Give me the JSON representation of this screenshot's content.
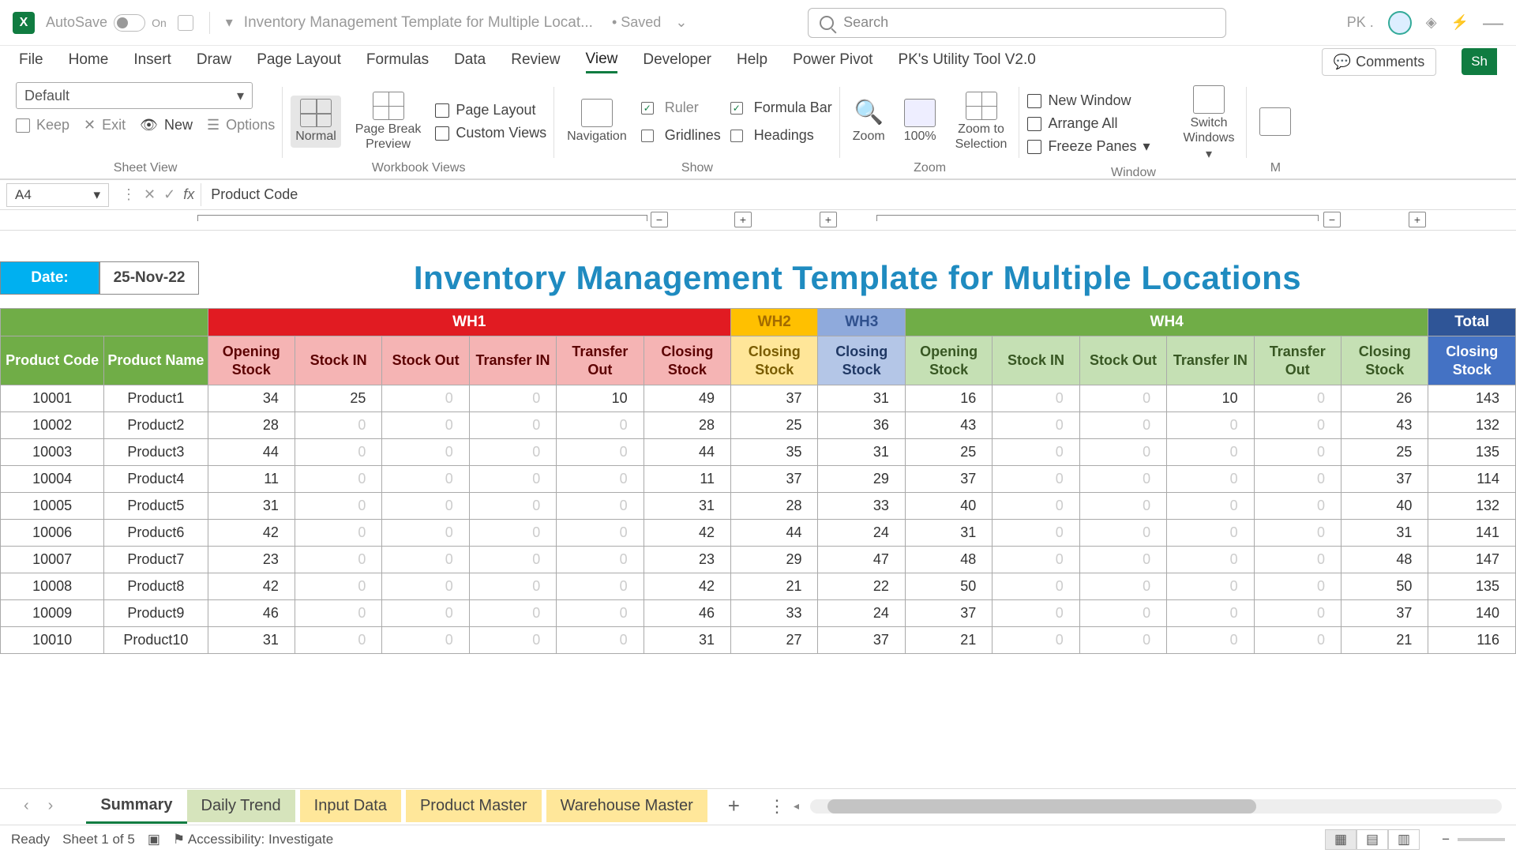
{
  "titlebar": {
    "autosave": "AutoSave",
    "autosave_state": "On",
    "doc_title": "Inventory Management Template for Multiple Locat...",
    "save_status": "• Saved",
    "search_placeholder": "Search",
    "user": "PK ."
  },
  "menu": {
    "tabs": [
      "File",
      "Home",
      "Insert",
      "Draw",
      "Page Layout",
      "Formulas",
      "Data",
      "Review",
      "View",
      "Developer",
      "Help",
      "Power Pivot",
      "PK's Utility Tool V2.0"
    ],
    "active": "View",
    "comments": "Comments",
    "share": "Sh"
  },
  "ribbon": {
    "sheetview": {
      "select": "Default",
      "keep": "Keep",
      "exit": "Exit",
      "new": "New",
      "options": "Options",
      "label": "Sheet View"
    },
    "workbook": {
      "normal": "Normal",
      "page_break": "Page Break\nPreview",
      "page_layout": "Page Layout",
      "custom_views": "Custom Views",
      "label": "Workbook Views"
    },
    "show": {
      "navigation": "Navigation",
      "ruler": "Ruler",
      "gridlines": "Gridlines",
      "formula_bar": "Formula Bar",
      "headings": "Headings",
      "label": "Show"
    },
    "zoom": {
      "zoom": "Zoom",
      "hundred": "100%",
      "selection": "Zoom to\nSelection",
      "label": "Zoom"
    },
    "window": {
      "new_window": "New Window",
      "arrange_all": "Arrange All",
      "freeze": "Freeze Panes",
      "switch": "Switch\nWindows",
      "label": "Window"
    },
    "macros": "M"
  },
  "formula": {
    "cell": "A4",
    "value": "Product Code"
  },
  "sheet": {
    "date_label": "Date:",
    "date_value": "25-Nov-22",
    "title": "Inventory Management Template for Multiple Locations",
    "warehouses": [
      "WH1",
      "WH2",
      "WH3",
      "WH4",
      "Total"
    ],
    "cols_info": [
      "Product Code",
      "Product Name"
    ],
    "cols_wh1": [
      "Opening Stock",
      "Stock IN",
      "Stock Out",
      "Transfer IN",
      "Transfer Out",
      "Closing Stock"
    ],
    "cols_single": "Closing Stock",
    "cols_wh4": [
      "Opening Stock",
      "Stock IN",
      "Stock Out",
      "Transfer IN",
      "Transfer Out",
      "Closing Stock"
    ],
    "cols_total": "Closing Stock",
    "rows": [
      {
        "code": "10001",
        "name": "Product1",
        "w1": [
          34,
          25,
          0,
          0,
          10,
          49
        ],
        "w2": 37,
        "w3": 31,
        "w4": [
          16,
          0,
          0,
          10,
          0,
          26
        ],
        "tot": 143
      },
      {
        "code": "10002",
        "name": "Product2",
        "w1": [
          28,
          0,
          0,
          0,
          0,
          28
        ],
        "w2": 25,
        "w3": 36,
        "w4": [
          43,
          0,
          0,
          0,
          0,
          43
        ],
        "tot": 132
      },
      {
        "code": "10003",
        "name": "Product3",
        "w1": [
          44,
          0,
          0,
          0,
          0,
          44
        ],
        "w2": 35,
        "w3": 31,
        "w4": [
          25,
          0,
          0,
          0,
          0,
          25
        ],
        "tot": 135
      },
      {
        "code": "10004",
        "name": "Product4",
        "w1": [
          11,
          0,
          0,
          0,
          0,
          11
        ],
        "w2": 37,
        "w3": 29,
        "w4": [
          37,
          0,
          0,
          0,
          0,
          37
        ],
        "tot": 114
      },
      {
        "code": "10005",
        "name": "Product5",
        "w1": [
          31,
          0,
          0,
          0,
          0,
          31
        ],
        "w2": 28,
        "w3": 33,
        "w4": [
          40,
          0,
          0,
          0,
          0,
          40
        ],
        "tot": 132
      },
      {
        "code": "10006",
        "name": "Product6",
        "w1": [
          42,
          0,
          0,
          0,
          0,
          42
        ],
        "w2": 44,
        "w3": 24,
        "w4": [
          31,
          0,
          0,
          0,
          0,
          31
        ],
        "tot": 141
      },
      {
        "code": "10007",
        "name": "Product7",
        "w1": [
          23,
          0,
          0,
          0,
          0,
          23
        ],
        "w2": 29,
        "w3": 47,
        "w4": [
          48,
          0,
          0,
          0,
          0,
          48
        ],
        "tot": 147
      },
      {
        "code": "10008",
        "name": "Product8",
        "w1": [
          42,
          0,
          0,
          0,
          0,
          42
        ],
        "w2": 21,
        "w3": 22,
        "w4": [
          50,
          0,
          0,
          0,
          0,
          50
        ],
        "tot": 135
      },
      {
        "code": "10009",
        "name": "Product9",
        "w1": [
          46,
          0,
          0,
          0,
          0,
          46
        ],
        "w2": 33,
        "w3": 24,
        "w4": [
          37,
          0,
          0,
          0,
          0,
          37
        ],
        "tot": 140
      },
      {
        "code": "10010",
        "name": "Product10",
        "w1": [
          31,
          0,
          0,
          0,
          0,
          31
        ],
        "w2": 27,
        "w3": 37,
        "w4": [
          21,
          0,
          0,
          0,
          0,
          21
        ],
        "tot": 116
      }
    ]
  },
  "tabs": {
    "items": [
      "Summary",
      "Daily Trend",
      "Input Data",
      "Product Master",
      "Warehouse Master"
    ],
    "active": "Summary"
  },
  "status": {
    "ready": "Ready",
    "sheet": "Sheet 1 of 5",
    "accessibility": "Accessibility: Investigate"
  }
}
